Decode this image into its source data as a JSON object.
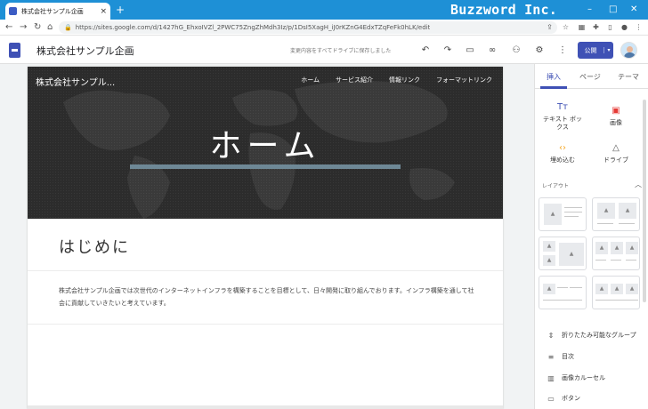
{
  "browser": {
    "tab_title": "株式会社サンプル企画",
    "tab_close": "×",
    "new_tab": "+",
    "brand": "Buzzword Inc.",
    "window_controls": [
      "–",
      "□",
      "✕"
    ],
    "url": "https://sites.google.com/d/1427hG_EhxoIVZl_2PWC75ZngZhMdh3Iz/p/1DsI5XagH_iJ0rKZnG4EdxTZqFeFk0hLK/edit",
    "lock_icon": "🔒"
  },
  "toolbar": {
    "site_name": "株式会社サンプル企画",
    "saved_message": "変更内容をすべてドライブに保存しました",
    "publish_label": "公開",
    "publish_dropdown": "▾"
  },
  "hero": {
    "site_title": "株式会社サンプル...",
    "menu": [
      "ホーム",
      "サービス紹介",
      "情報リンク",
      "フォーマットリンク"
    ],
    "page_title": "ホーム"
  },
  "content": {
    "heading": "はじめに",
    "body": "株式会社サンプル企画では次世代のインターネットインフラを構築することを目標として、日々開発に取り組んでおります。インフラ構築を通して社会に貢献していきたいと考えています。"
  },
  "panel": {
    "tabs": [
      "挿入",
      "ページ",
      "テーマ"
    ],
    "tools": [
      {
        "icon": "Tт",
        "label": "テキスト ボックス"
      },
      {
        "icon": "▣",
        "label": "画像"
      },
      {
        "icon": "‹›",
        "label": "埋め込む"
      },
      {
        "icon": "△",
        "label": "ドライブ"
      }
    ],
    "layouts_header": "レイアウト",
    "collapse_icon": "︿",
    "items": [
      {
        "icon": "⇕",
        "label": "折りたたみ可能なグループ"
      },
      {
        "icon": "≡",
        "label": "目次"
      },
      {
        "icon": "▥",
        "label": "画像カルーセル"
      },
      {
        "icon": "▭",
        "label": "ボタン"
      }
    ]
  },
  "colors": {
    "accent": "#3f51b5",
    "tabstrip": "#1e90d6",
    "hero_bg": "#2c2c2c"
  }
}
